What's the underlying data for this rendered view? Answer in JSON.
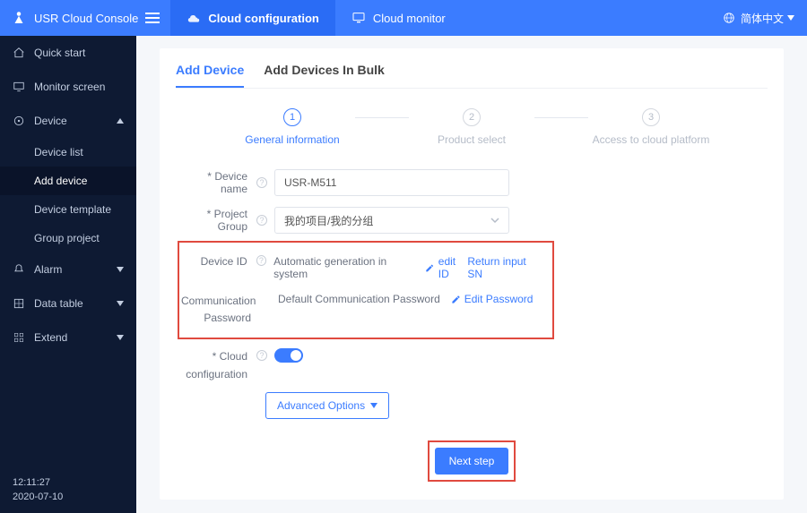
{
  "header": {
    "brand": "USR Cloud Console",
    "tabs": [
      {
        "label": "Cloud configuration",
        "active": true
      },
      {
        "label": "Cloud monitor",
        "active": false
      }
    ],
    "language": "简体中文"
  },
  "sidebar": {
    "items": [
      {
        "label": "Quick start",
        "icon": "house"
      },
      {
        "label": "Monitor screen",
        "icon": "monitor"
      },
      {
        "label": "Device",
        "icon": "device",
        "expanded": true,
        "children": [
          {
            "label": "Device list"
          },
          {
            "label": "Add device",
            "active": true
          },
          {
            "label": "Device template"
          },
          {
            "label": "Group project"
          }
        ]
      },
      {
        "label": "Alarm",
        "icon": "alarm",
        "expandable": true
      },
      {
        "label": "Data table",
        "icon": "table",
        "expandable": true
      },
      {
        "label": "Extend",
        "icon": "extend",
        "expandable": true
      }
    ],
    "time": "12:11:27",
    "date": "2020-07-10"
  },
  "page": {
    "tabs": [
      {
        "label": "Add Device",
        "active": true
      },
      {
        "label": "Add Devices In Bulk",
        "active": false
      }
    ],
    "steps": [
      {
        "num": "1",
        "label": "General information",
        "active": true
      },
      {
        "num": "2",
        "label": "Product select",
        "active": false
      },
      {
        "num": "3",
        "label": "Access to cloud platform",
        "active": false
      }
    ],
    "form": {
      "device_name_label": "Device name",
      "device_name_value": "USR-M511",
      "project_group_label": "Project Group",
      "project_group_value": "我的项目/我的分组",
      "device_id_label": "Device ID",
      "device_id_text": "Automatic generation in system",
      "edit_id_label": "edit ID",
      "return_sn_label": "Return input SN",
      "comm_pw_label_line1": "Communication",
      "comm_pw_label_line2": "Password",
      "comm_pw_text": "Default Communication Password",
      "edit_pw_label": "Edit Password",
      "cloud_cfg_label_line1": "Cloud",
      "cloud_cfg_label_line2": "configuration",
      "cloud_cfg_required_prefix": "* ",
      "advanced_label": "Advanced Options",
      "next_label": "Next step"
    }
  }
}
